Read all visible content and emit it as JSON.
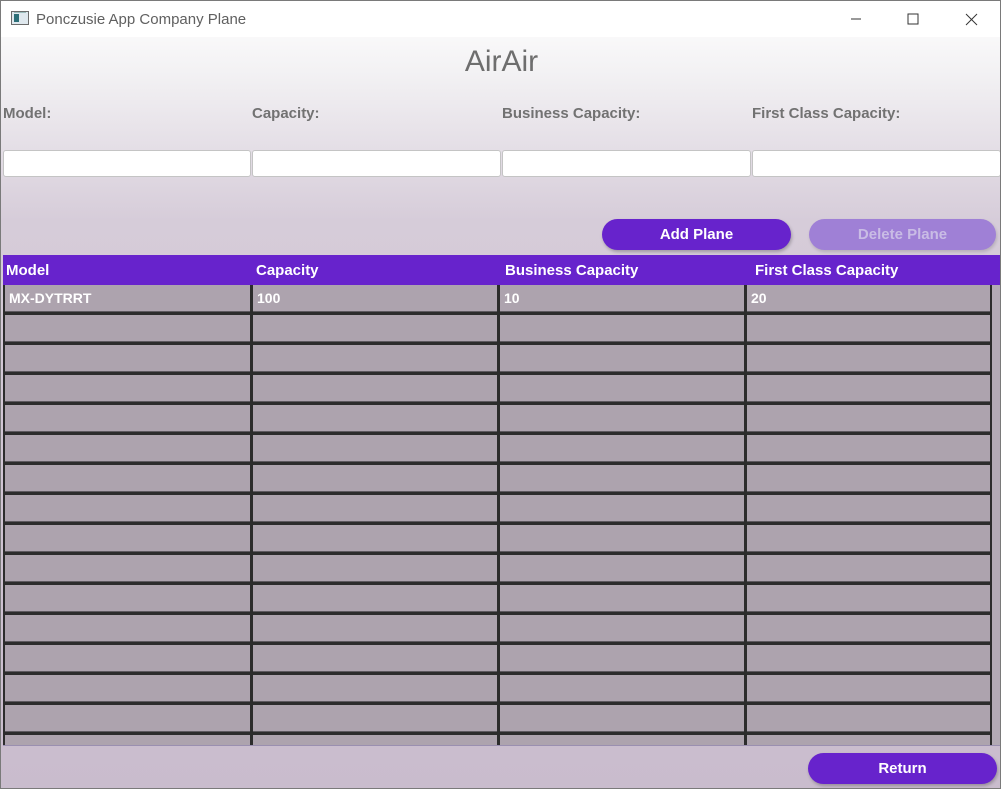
{
  "window": {
    "title": "Ponczusie App Company Plane"
  },
  "header": {
    "title": "AirAir"
  },
  "form": {
    "fields": [
      {
        "label": "Model:",
        "value": "",
        "placeholder": ""
      },
      {
        "label": "Capacity:",
        "value": "",
        "placeholder": ""
      },
      {
        "label": "Business Capacity:",
        "value": "",
        "placeholder": ""
      },
      {
        "label": "First Class Capacity:",
        "value": "",
        "placeholder": ""
      }
    ]
  },
  "actions": {
    "add_label": "Add Plane",
    "delete_label": "Delete Plane",
    "delete_enabled": false,
    "return_label": "Return"
  },
  "table": {
    "columns": [
      "Model",
      "Capacity",
      "Business Capacity",
      "First Class Capacity"
    ],
    "rows": [
      [
        "MX-DYTRRT",
        "100",
        "10",
        "20"
      ],
      [
        "",
        "",
        "",
        ""
      ],
      [
        "",
        "",
        "",
        ""
      ],
      [
        "",
        "",
        "",
        ""
      ],
      [
        "",
        "",
        "",
        ""
      ],
      [
        "",
        "",
        "",
        ""
      ],
      [
        "",
        "",
        "",
        ""
      ],
      [
        "",
        "",
        "",
        ""
      ],
      [
        "",
        "",
        "",
        ""
      ],
      [
        "",
        "",
        "",
        ""
      ],
      [
        "",
        "",
        "",
        ""
      ],
      [
        "",
        "",
        "",
        ""
      ],
      [
        "",
        "",
        "",
        ""
      ],
      [
        "",
        "",
        "",
        ""
      ],
      [
        "",
        "",
        "",
        ""
      ],
      [
        "",
        "",
        "",
        ""
      ]
    ]
  },
  "colors": {
    "accent": "#6723cc",
    "accent_disabled": "#9f80d6",
    "row_background": "#ada3ae",
    "grid_line": "#2c2c2c"
  },
  "icons": {
    "app": "window-app-icon",
    "minimize": "minimize-icon",
    "maximize": "maximize-icon",
    "close": "close-icon"
  }
}
